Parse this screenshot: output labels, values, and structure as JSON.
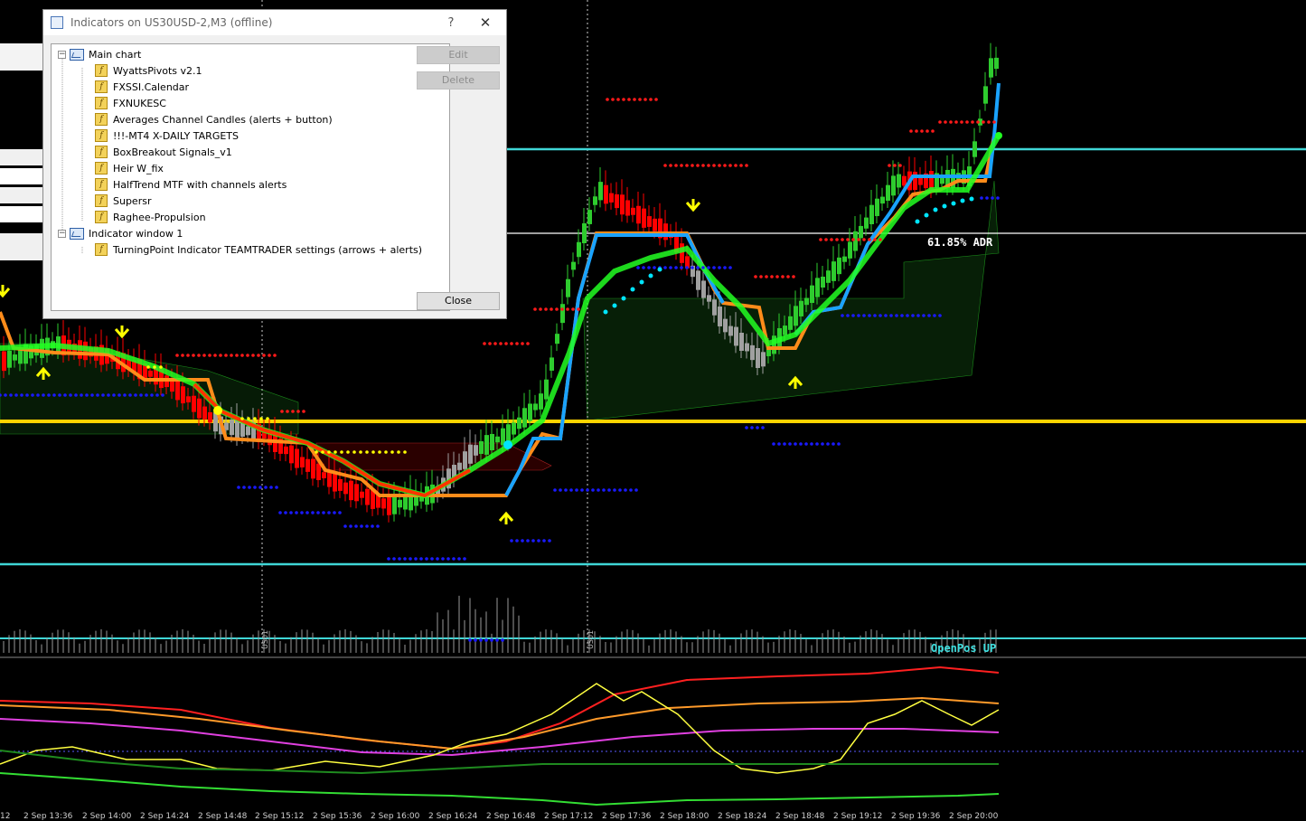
{
  "dialog": {
    "title": "Indicators on US30USD-2,M3 (offline)",
    "help_glyph": "?",
    "close_glyph": "✕",
    "buttons": {
      "edit": "Edit",
      "delete": "Delete",
      "close": "Close"
    },
    "tree": {
      "main_chart": {
        "label": "Main chart",
        "items": [
          "WyattsPivots v2.1",
          "FXSSI.Calendar",
          "FXNUKESC",
          "Averages Channel Candles  (alerts + button)",
          "!!!-MT4 X-DAILY TARGETS",
          "BoxBreakout Signals_v1",
          "Heir W_fix",
          "HalfTrend MTF with channels alerts",
          "Supersr",
          "Raghee-Propulsion"
        ]
      },
      "indicator_window": {
        "label": "Indicator window 1",
        "items": [
          "TurningPoint Indicator TEAMTRADER settings (arrows + alerts)"
        ]
      }
    }
  },
  "chart": {
    "adr_label": "61.85% ADR",
    "openpos_label": "OpenPos UP",
    "vline_labels": [
      "US01",
      "US01"
    ],
    "time_labels": [
      "12",
      "2 Sep 13:36",
      "2 Sep 14:00",
      "2 Sep 14:24",
      "2 Sep 14:48",
      "2 Sep 15:12",
      "2 Sep 15:36",
      "2 Sep 16:00",
      "2 Sep 16:24",
      "2 Sep 16:48",
      "2 Sep 17:12",
      "2 Sep 17:36",
      "2 Sep 18:00",
      "2 Sep 18:24",
      "2 Sep 18:48",
      "2 Sep 19:12",
      "2 Sep 19:36",
      "2 Sep 20:00"
    ],
    "colors": {
      "background": "#000000",
      "bull_candle": "#2ecc2e",
      "bear_candle": "#ff0000",
      "neutral_candle": "#a0a0a0",
      "cyan_level": "#3fd6d6",
      "yellow_level": "#ffd400",
      "blue_line": "#1aa3ff",
      "orange_line": "#ff8c1a",
      "green_band": "#22ff22",
      "arrow": "#ffff00",
      "red_dots": "#ff1a1a",
      "blue_dots": "#1a1aff",
      "label_text": "#3fe0e0"
    }
  }
}
